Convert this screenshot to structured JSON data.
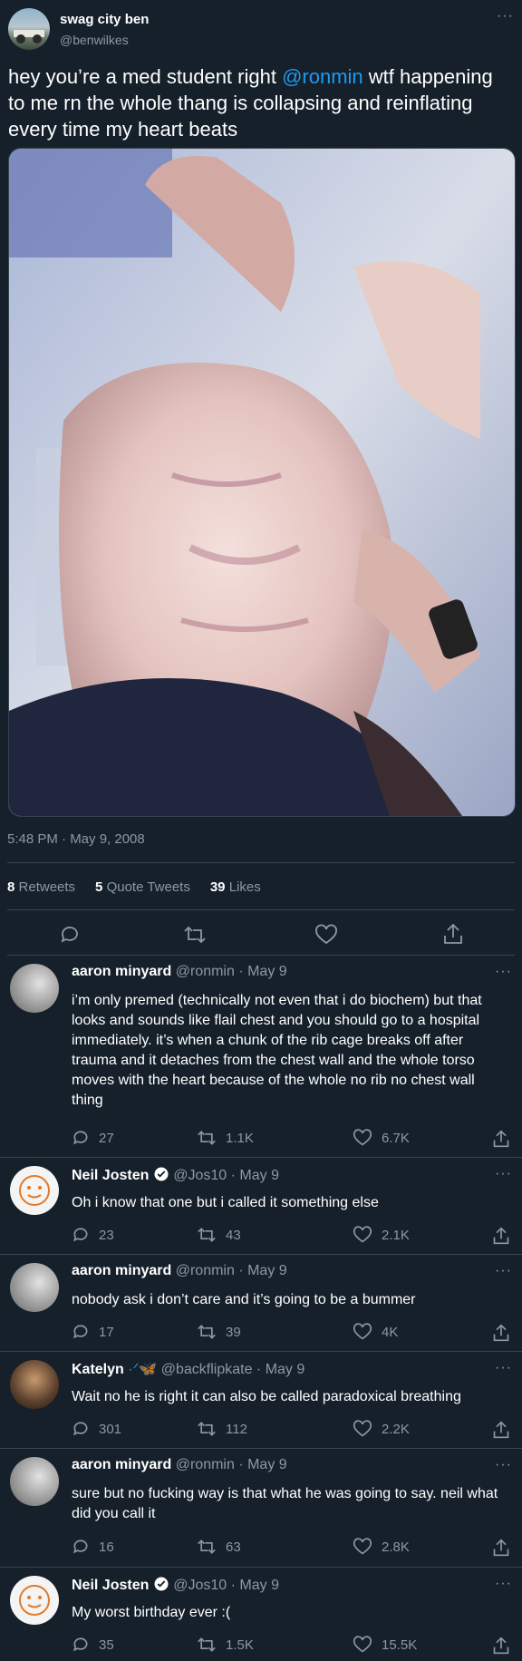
{
  "tweet": {
    "display_name": "swag city ben",
    "handle": "@benwilkes",
    "text_before": "hey you’re a med student right ",
    "mention": "@ronmin",
    "text_after": " wtf happening to me rn the whole thang is collapsing and reinflating every time my heart beats",
    "timestamp": "5:48 PM · May 9, 2008",
    "retweets_count": "8",
    "retweets_label": "Retweets",
    "quotes_count": "5",
    "quotes_label": "Quote Tweets",
    "likes_count": "39",
    "likes_label": "Likes"
  },
  "replies": [
    {
      "name": "aaron minyard",
      "meta": "@ronmin · May 9",
      "text": "i’m only premed (technically not even that i do biochem) but that looks and sounds like flail chest and you should go to a hospital immediately. it’s when a chunk of the rib cage breaks off after trauma and it detaches from the chest wall and the whole torso moves with the heart because of the whole no rib no chest wall thing",
      "replies": "27",
      "retweets": "1.1K",
      "likes": "6.7K"
    },
    {
      "name": "Neil Josten",
      "meta": "@Jos10 · May 9",
      "text": "Oh i know that one but i called it something else",
      "replies": "23",
      "retweets": "43",
      "likes": "2.1K"
    },
    {
      "name": "aaron minyard",
      "meta": "@ronmin · May 9",
      "text": "nobody ask i don’t care and it’s going to be a bummer",
      "replies": "17",
      "retweets": "39",
      "likes": "4K"
    },
    {
      "name": "Katelyn",
      "meta": "@backflipkate · May 9",
      "text": "Wait no he is right it can also be called paradoxical breathing",
      "replies": "301",
      "retweets": "112",
      "likes": "2.2K"
    },
    {
      "name": "aaron minyard",
      "meta": "@ronmin · May 9",
      "text": "sure but no fucking way is that what he was going to say. neil what did you call it",
      "replies": "16",
      "retweets": "63",
      "likes": "2.8K"
    },
    {
      "name": "Neil Josten",
      "meta": "@Jos10 · May 9",
      "text": "My worst birthday ever :(",
      "replies": "35",
      "retweets": "1.5K",
      "likes": "15.5K"
    }
  ],
  "icons": {
    "reply": "reply-icon",
    "retweet": "retweet-icon",
    "like": "heart-icon",
    "share": "share-icon",
    "more": "more-icon",
    "verified": "verified-badge-icon"
  },
  "colors": {
    "background": "#15202b",
    "accent": "#1d9bf0",
    "muted": "#8b98a5",
    "divider": "#38444d"
  }
}
